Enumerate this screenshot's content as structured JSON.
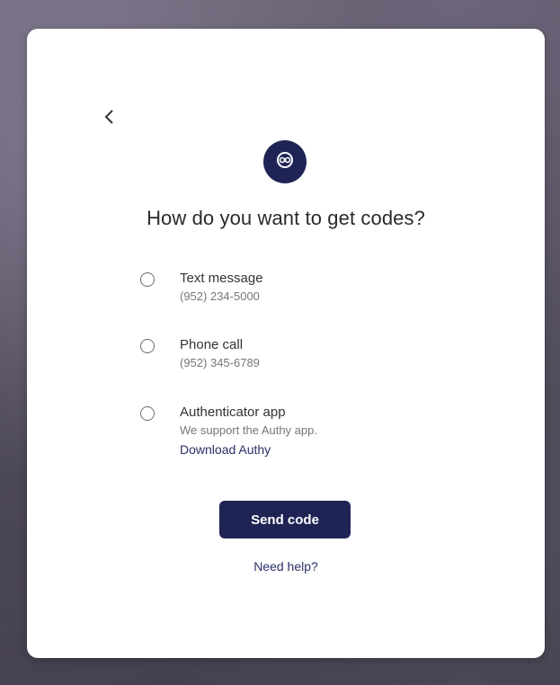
{
  "dialog": {
    "title": "How do you want to get codes?",
    "back_icon": "chevron-left-icon",
    "logo_icon": "brand-logo-icon",
    "brand_color": "#1f2455"
  },
  "options": [
    {
      "label": "Text message",
      "detail": "(952) 234-5000",
      "selected": false
    },
    {
      "label": "Phone call",
      "detail": "(952) 345-6789",
      "selected": false
    },
    {
      "label": "Authenticator app",
      "detail": "We support the Authy app.",
      "link": "Download Authy",
      "selected": false
    }
  ],
  "actions": {
    "send_label": "Send code",
    "help_label": "Need help?"
  }
}
